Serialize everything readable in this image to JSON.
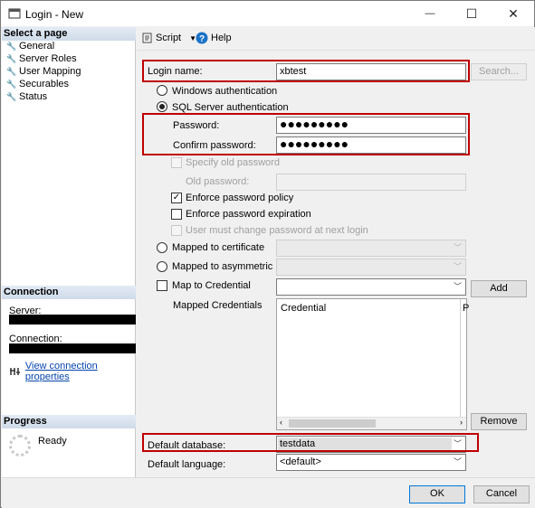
{
  "window": {
    "title": "Login - New",
    "minimize_glyph": "—",
    "maximize_glyph": "☐",
    "close_glyph": "✕"
  },
  "left": {
    "select_page": "Select a page",
    "pages": [
      "General",
      "Server Roles",
      "User Mapping",
      "Securables",
      "Status"
    ],
    "connection_head": "Connection",
    "server_label": "Server:",
    "connection_label": "Connection:",
    "view_props": "View connection properties",
    "progress_head": "Progress",
    "progress_status": "Ready"
  },
  "toolbar": {
    "script_label": "Script",
    "help_label": "Help"
  },
  "form": {
    "login_name_label": "Login name:",
    "login_name_value": "xbtest",
    "search_button": "Search...",
    "windows_auth": "Windows authentication",
    "sql_auth": "SQL Server authentication",
    "password_label": "Password:",
    "password_value": "●●●●●●●●●",
    "confirm_label": "Confirm password:",
    "confirm_value": "●●●●●●●●●",
    "specify_old": "Specify old password",
    "old_password_label": "Old password:",
    "enforce_policy": "Enforce password policy",
    "enforce_expiration": "Enforce password expiration",
    "must_change": "User must change password at next login",
    "mapped_cert": "Mapped to certificate",
    "mapped_asym": "Mapped to asymmetric key",
    "map_credential": "Map to Credential",
    "add_button": "Add",
    "mapped_credentials": "Mapped Credentials",
    "grid_col_credential": "Credential",
    "grid_col_provider": "P",
    "remove_button": "Remove",
    "default_db_label": "Default database:",
    "default_db_value": "testdata",
    "default_lang_label": "Default language:",
    "default_lang_value": "<default>"
  },
  "footer": {
    "ok": "OK",
    "cancel": "Cancel"
  },
  "colors": {
    "highlight_border": "#c00000",
    "section_gradient": "#cfdbe9",
    "link": "#0645ad"
  }
}
